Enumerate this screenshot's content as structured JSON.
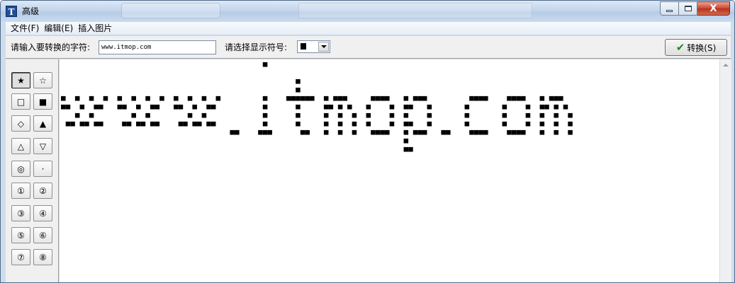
{
  "window": {
    "title": "高级",
    "app_icon": "T",
    "close_glyph": "X"
  },
  "menu": {
    "items": [
      "文件(F)",
      "编辑(E)",
      "插入图片"
    ]
  },
  "toolbar": {
    "input_label": "请输入要转换的字符:",
    "input_value": "www.itmop.com",
    "symbol_label": "请选择显示符号:",
    "selected_symbol": "■",
    "convert_label": "转换(S)",
    "convert_icon": "check-icon"
  },
  "symbols": [
    "★",
    "☆",
    "□",
    "■",
    "◇",
    "▲",
    "△",
    "▽",
    "◎",
    "·",
    "①",
    "②",
    "③",
    "④",
    "⑤",
    "⑥",
    "⑦",
    "⑧"
  ],
  "selected_symbol_index": 0,
  "canvas": {
    "source_text": "www.itmop.com",
    "render_symbol": "■"
  }
}
